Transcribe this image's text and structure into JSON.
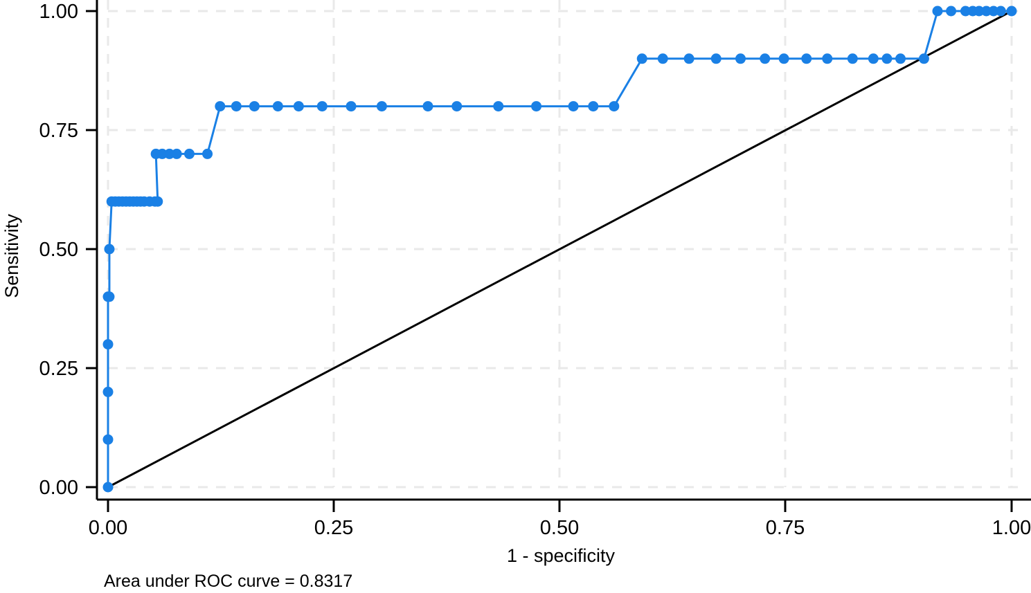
{
  "figure": {
    "background_color": "#ffffff",
    "note": "Area under ROC curve = 0.8317"
  },
  "chart_data": {
    "type": "line",
    "title": "",
    "subtitle": "",
    "xlabel": "1 - specificity",
    "ylabel": "Sensitivity",
    "xlim": [
      0.0,
      1.0
    ],
    "ylim": [
      0.0,
      1.0
    ],
    "xticks": [
      0.0,
      0.25,
      0.5,
      0.75,
      1.0
    ],
    "xticklabels": [
      "0.00",
      "0.25",
      "0.50",
      "0.75",
      "1.00"
    ],
    "yticks": [
      0.0,
      0.25,
      0.5,
      0.75,
      1.0
    ],
    "yticklabels": [
      "0.00",
      "0.25",
      "0.50",
      "0.75",
      "1.00"
    ],
    "grid": true,
    "grid_style": "dashed",
    "grid_color": "#e9e9e9",
    "legend": false,
    "annotations": [
      {
        "name": "auc-annotation",
        "text": "Area under ROC curve = 0.8317",
        "value": 0.8317
      }
    ],
    "series": [
      {
        "name": "ROC curve",
        "color": "#1a80e5",
        "marker": "circle",
        "marker_size": 10,
        "line_width": 3,
        "x": [
          0.0,
          0.0,
          0.0,
          0.0,
          0.0,
          0.0015,
          0.0015,
          0.004,
          0.008,
          0.012,
          0.016,
          0.02,
          0.024,
          0.028,
          0.032,
          0.036,
          0.04,
          0.046,
          0.052,
          0.055,
          0.053,
          0.06,
          0.068,
          0.076,
          0.09,
          0.11,
          0.124,
          0.142,
          0.162,
          0.188,
          0.211,
          0.237,
          0.269,
          0.303,
          0.354,
          0.386,
          0.432,
          0.474,
          0.515,
          0.537,
          0.56,
          0.591,
          0.614,
          0.643,
          0.673,
          0.7,
          0.727,
          0.748,
          0.773,
          0.796,
          0.824,
          0.847,
          0.862,
          0.877,
          0.903,
          0.918,
          0.933,
          0.949,
          0.957,
          0.964,
          0.972,
          0.98,
          0.988,
          1.0
        ],
        "y": [
          0.0,
          0.1,
          0.2,
          0.3,
          0.4,
          0.4,
          0.5,
          0.6,
          0.6,
          0.6,
          0.6,
          0.6,
          0.6,
          0.6,
          0.6,
          0.6,
          0.6,
          0.6,
          0.6,
          0.6,
          0.7,
          0.7,
          0.7,
          0.7,
          0.7,
          0.7,
          0.8,
          0.8,
          0.8,
          0.8,
          0.8,
          0.8,
          0.8,
          0.8,
          0.8,
          0.8,
          0.8,
          0.8,
          0.8,
          0.8,
          0.8,
          0.9,
          0.9,
          0.9,
          0.9,
          0.9,
          0.9,
          0.9,
          0.9,
          0.9,
          0.9,
          0.9,
          0.9,
          0.9,
          0.9,
          1.0,
          1.0,
          1.0,
          1.0,
          1.0,
          1.0,
          1.0,
          1.0,
          1.0
        ]
      },
      {
        "name": "Reference diagonal",
        "color": "#000000",
        "marker": "none",
        "line_width": 3,
        "x": [
          0.0,
          1.0
        ],
        "y": [
          0.0,
          1.0
        ]
      }
    ]
  }
}
